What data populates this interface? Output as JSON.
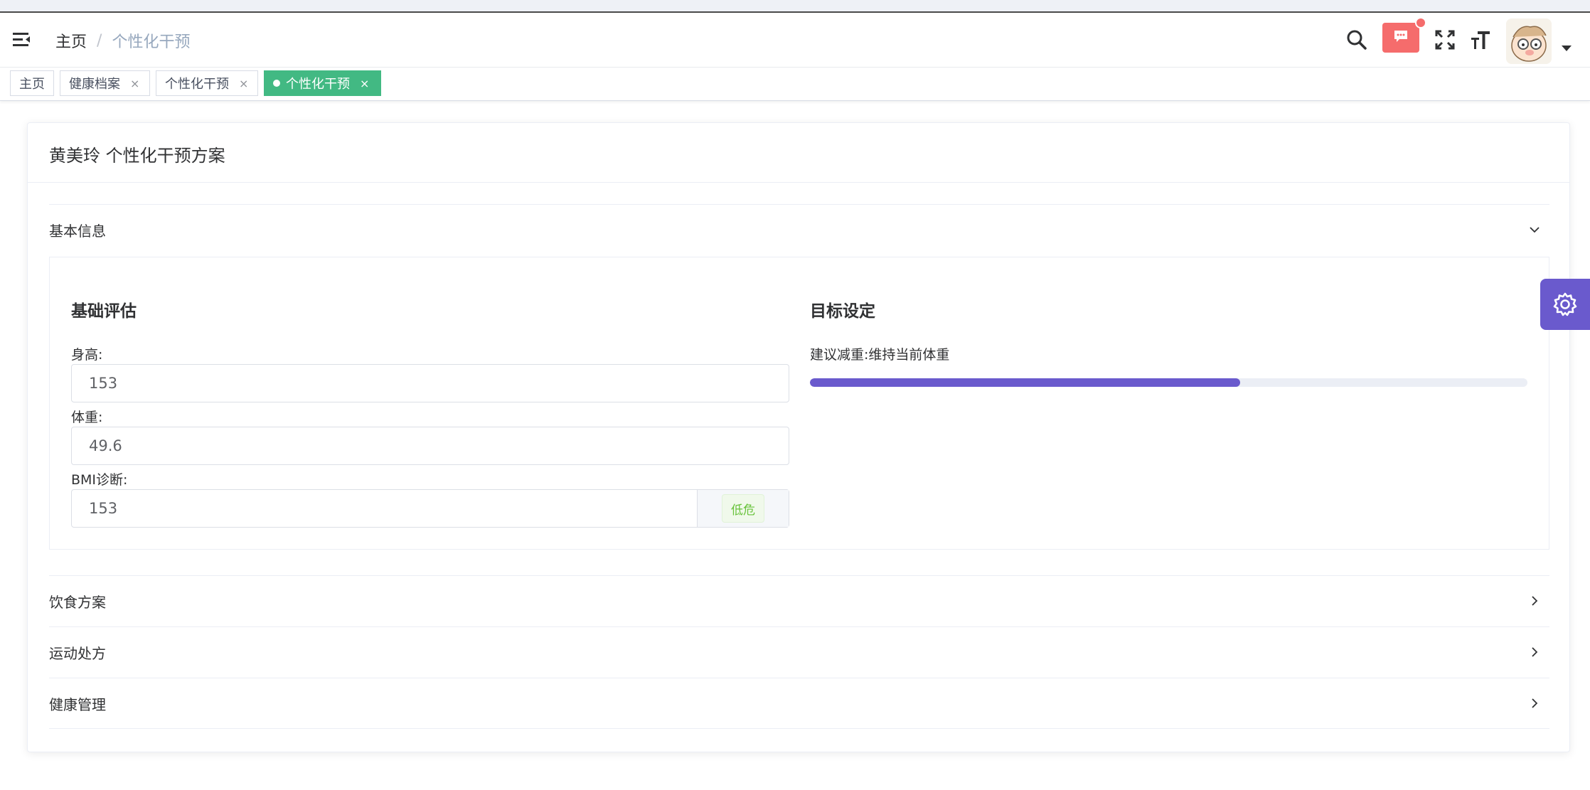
{
  "header": {
    "breadcrumb": {
      "home": "主页",
      "separator": "/",
      "current": "个性化干预"
    },
    "icons": [
      "hamburger-icon",
      "search-icon",
      "message-icon",
      "fullscreen-icon",
      "font-size-icon"
    ],
    "accent_message": "#f56c6c"
  },
  "tags": [
    {
      "label": "主页",
      "closable": false,
      "active": false
    },
    {
      "label": "健康档案",
      "closable": true,
      "active": false
    },
    {
      "label": "个性化干预",
      "closable": true,
      "active": false
    },
    {
      "label": "个性化干预",
      "closable": true,
      "active": true
    }
  ],
  "tag_close": "×",
  "card": {
    "title": "黄美玲 个性化干预方案"
  },
  "sections": {
    "basic": {
      "title": "基本信息",
      "expanded": true
    },
    "diet": {
      "title": "饮食方案",
      "expanded": false
    },
    "exercise": {
      "title": "运动处方",
      "expanded": false
    },
    "health": {
      "title": "健康管理",
      "expanded": false
    }
  },
  "assessment": {
    "title": "基础评估",
    "height_label": "身高:",
    "height_value": "153",
    "weight_label": "体重:",
    "weight_value": "49.6",
    "bmi_label": "BMI诊断:",
    "bmi_value": "153",
    "risk_badge": "低危"
  },
  "goal": {
    "title": "目标设定",
    "suggestion_label": "建议减重:",
    "suggestion_value": "维持当前体重",
    "progress_percent": 60,
    "progress_color": "#6a5acd"
  },
  "settings_tab": {
    "icon": "gear-icon",
    "color": "#6a5acd"
  }
}
